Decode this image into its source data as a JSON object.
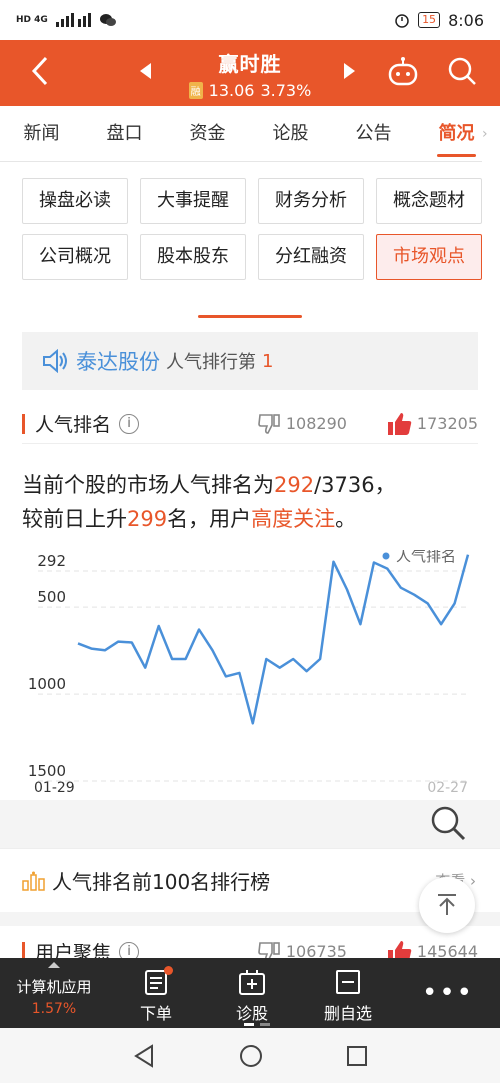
{
  "status_bar": {
    "carrier_left": "HD 4G",
    "time": "8:06",
    "battery": "15"
  },
  "header": {
    "stock_name": "赢时胜",
    "rong_badge": "融",
    "price": "13.06",
    "change_pct": "3.73%"
  },
  "tabs": [
    {
      "label": "新闻",
      "active": false
    },
    {
      "label": "盘口",
      "active": false
    },
    {
      "label": "资金",
      "active": false
    },
    {
      "label": "论股",
      "active": false
    },
    {
      "label": "公告",
      "active": false
    },
    {
      "label": "简况",
      "active": true
    }
  ],
  "grid_buttons": [
    {
      "label": "操盘必读",
      "active": false
    },
    {
      "label": "大事提醒",
      "active": false
    },
    {
      "label": "财务分析",
      "active": false
    },
    {
      "label": "概念题材",
      "active": false
    },
    {
      "label": "公司概况",
      "active": false
    },
    {
      "label": "股本股东",
      "active": false
    },
    {
      "label": "分红融资",
      "active": false
    },
    {
      "label": "市场观点",
      "active": true
    }
  ],
  "banner": {
    "company": "泰达股份",
    "text": "人气排行第",
    "rank": "1"
  },
  "popularity_section": {
    "title": "人气排名",
    "info": "i",
    "down_count": "108290",
    "up_count": "173205"
  },
  "description": {
    "line1_prefix": "当前个股的市场人气排名为",
    "rank_value": "292",
    "line1_suffix": "/3736，",
    "line2_prefix": "较前日上升",
    "rise_value": "299",
    "line2_middle": "名，用户",
    "attention": "高度关注",
    "line2_suffix": "。"
  },
  "chart_data": {
    "type": "line",
    "legend": "人气排名",
    "legend_position": "top-right",
    "y_reversed": true,
    "ylim": [
      1500,
      292
    ],
    "y_ticks": [
      "292",
      "500",
      "1000",
      "1500"
    ],
    "x_start_label": "01-29",
    "x_end_label": "02-27",
    "series": [
      {
        "name": "人气排名",
        "color": "#4a90d9",
        "values": [
          760,
          790,
          800,
          750,
          755,
          900,
          660,
          850,
          850,
          680,
          800,
          950,
          930,
          1220,
          850,
          900,
          850,
          920,
          850,
          290,
          450,
          650,
          295,
          330,
          440,
          480,
          530,
          650,
          530,
          250
        ]
      }
    ]
  },
  "top100_row": {
    "label": "人气排名前100名排行榜",
    "more": "查看"
  },
  "next_section": {
    "title": "用户聚焦",
    "down_count": "106735",
    "up_count": "145644"
  },
  "bottom_bar": {
    "sector_name": "计算机应用",
    "sector_pct": "1.57%",
    "items": [
      "下单",
      "诊股",
      "删自选"
    ],
    "more": "•••"
  },
  "colors": {
    "brand": "#e8562a",
    "line": "#4a90d9"
  }
}
